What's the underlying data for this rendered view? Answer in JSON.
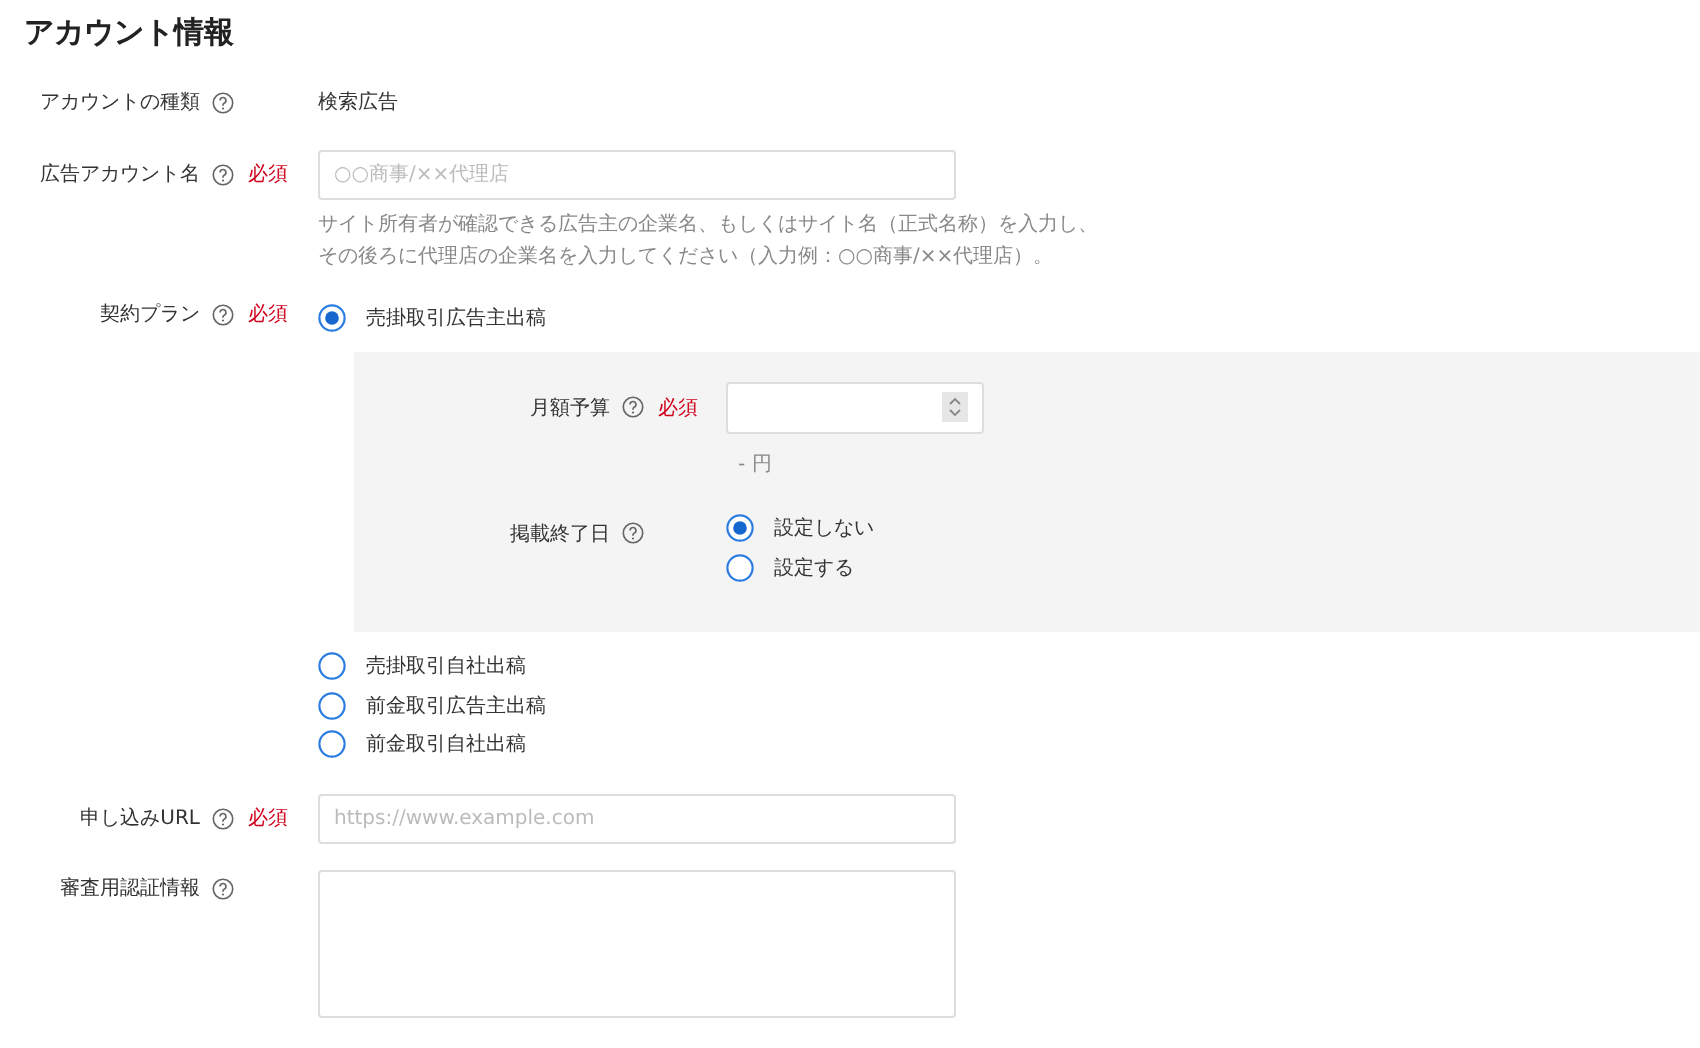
{
  "title": "アカウント情報",
  "fields": [
    {
      "kind": "value",
      "label": "アカウントの種類",
      "value": "検索広告"
    },
    {
      "kind": "input",
      "label": "広告アカウント名",
      "required_label": "必須",
      "placeholder": "○○商事/××代理店",
      "note": [
        "サイト所有者が確認できる広告主の企業名、もしくはサイト名（正式名称）を入力し、",
        "その後ろに代理店の企業名を入力してください（入力例：○○商事/××代理店）。"
      ]
    },
    {
      "kind": "radio",
      "label": "契約プラン",
      "required_label": "必須",
      "options": [
        {
          "label": "売掛取引広告主出稿",
          "selected": true,
          "panel": [
            {
              "kind": "number",
              "label": "月額予算",
              "required_label": "必須",
              "unit": "- 円"
            },
            {
              "kind": "radio",
              "label": "掲載終了日",
              "options": [
                {
                  "label": "設定しない",
                  "selected": true
                },
                {
                  "label": "設定する",
                  "selected": false
                }
              ]
            }
          ]
        },
        {
          "label": "売掛取引自社出稿",
          "selected": false
        },
        {
          "label": "前金取引広告主出稿",
          "selected": false
        },
        {
          "label": "前金取引自社出稿",
          "selected": false
        }
      ]
    },
    {
      "kind": "input",
      "label": "申し込みURL",
      "required_label": "必須",
      "placeholder": "https://www.example.com"
    },
    {
      "kind": "textarea",
      "label": "審査用認証情報"
    }
  ]
}
